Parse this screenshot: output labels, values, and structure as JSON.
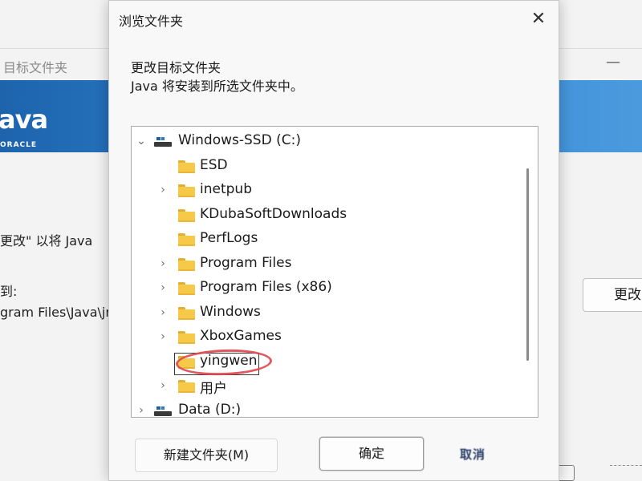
{
  "background_window": {
    "title": "目标文件夹",
    "logo": {
      "word": "ava",
      "sub": "ORACLE"
    },
    "body_line1": "更改\" 以将 Java",
    "body_line2": "到:",
    "body_line3": "gram Files\\Java\\jr",
    "change_button_label": "更改"
  },
  "dialog": {
    "title": "浏览文件夹",
    "heading": "更改目标文件夹",
    "description": "Java 将安装到所选文件夹中。",
    "tree": {
      "items": [
        {
          "label": "Windows-SSD (C:)",
          "type": "drive",
          "expanded": true
        },
        {
          "label": "ESD",
          "type": "folder",
          "expandable": false
        },
        {
          "label": "inetpub",
          "type": "folder",
          "expandable": true
        },
        {
          "label": "KDubaSoftDownloads",
          "type": "folder",
          "expandable": false
        },
        {
          "label": "PerfLogs",
          "type": "folder",
          "expandable": false
        },
        {
          "label": "Program Files",
          "type": "folder",
          "expandable": true
        },
        {
          "label": "Program Files (x86)",
          "type": "folder",
          "expandable": true
        },
        {
          "label": "Windows",
          "type": "folder",
          "expandable": true
        },
        {
          "label": "XboxGames",
          "type": "folder",
          "expandable": true
        },
        {
          "label": "yingwen",
          "type": "folder",
          "expandable": false,
          "selected": true,
          "editing": true
        },
        {
          "label": "用户",
          "type": "folder",
          "expandable": true
        },
        {
          "label": "Data (D:)",
          "type": "drive",
          "expanded": false
        }
      ]
    },
    "buttons": {
      "new_folder": "新建文件夹(M)",
      "ok": "确定",
      "cancel": "取消"
    }
  },
  "colors": {
    "banner": "#2f82cd",
    "folder": "#f7c948",
    "annotation": "#e0454d"
  }
}
